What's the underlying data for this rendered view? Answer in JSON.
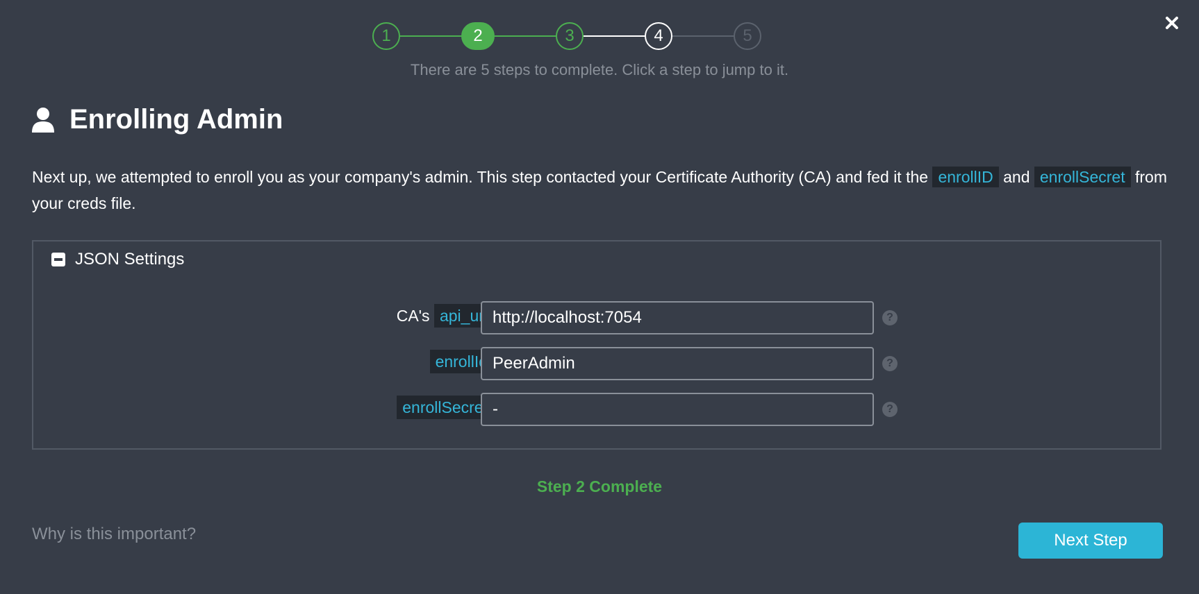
{
  "stepper": {
    "steps": [
      "1",
      "2",
      "3",
      "4",
      "5"
    ],
    "hint": "There are 5 steps to complete. Click a step to jump to it."
  },
  "title": "Enrolling Admin",
  "intro": {
    "part1": "Next up, we attempted to enroll you as your company's admin. This step contacted your Certificate Authority (CA) and fed it the ",
    "code1": "enrollID",
    "part2": " and ",
    "code2": "enrollSecret",
    "part3": " from your creds file."
  },
  "panel": {
    "toggle_label": "JSON Settings",
    "fields": {
      "api_url": {
        "prefix": "CA's ",
        "label": "api_url",
        "value": "http://localhost:7054"
      },
      "enroll_id": {
        "label": "enrollId",
        "value": "PeerAdmin"
      },
      "enroll_secret": {
        "label": "enrollSecret",
        "value": "-"
      }
    }
  },
  "status": "Step 2 Complete",
  "footer": {
    "why_link": "Why is this important?",
    "next_button": "Next Step"
  },
  "colors": {
    "background": "#373d48",
    "success": "#4caf50",
    "accent": "#2cb5d6",
    "code_text": "#35b6d9"
  },
  "icons": {
    "close": "close-icon",
    "user": "user-icon",
    "toggle": "minus-square-icon",
    "help": "question-circle-icon"
  }
}
